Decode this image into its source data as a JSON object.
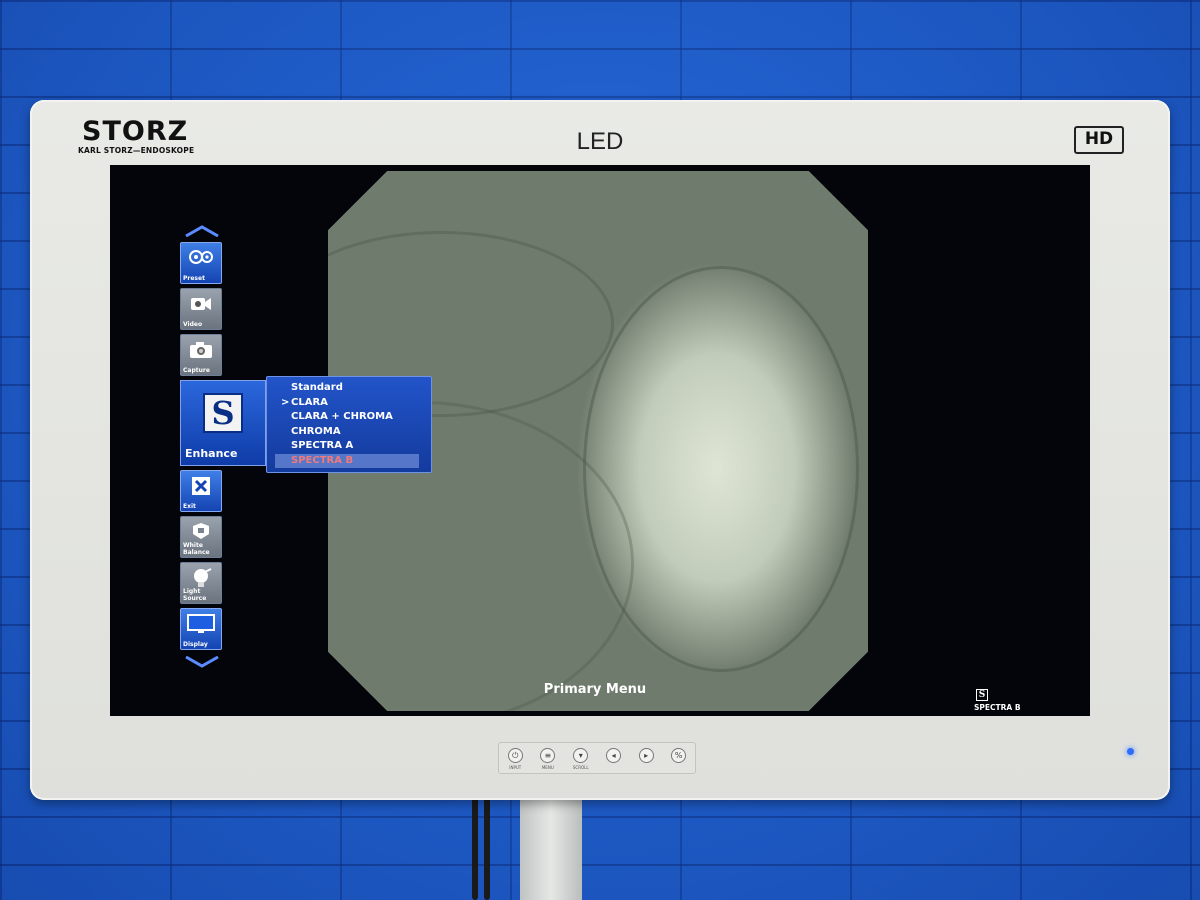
{
  "monitor": {
    "brand": "STORZ",
    "brand_sub": "KARL STORZ—ENDOSKOPE",
    "model_label": "LED",
    "badge": "HD"
  },
  "side_menu": {
    "items": [
      {
        "id": "preset",
        "label": "Preset",
        "icon": "gears-icon"
      },
      {
        "id": "video",
        "label": "Video",
        "icon": "video-camera-icon"
      },
      {
        "id": "capture",
        "label": "Capture",
        "icon": "camera-icon"
      },
      {
        "id": "enhance",
        "label": "Enhance",
        "icon": "s-enhance-icon"
      },
      {
        "id": "exit",
        "label": "Exit",
        "icon": "close-icon"
      },
      {
        "id": "white_balance",
        "label": "White Balance",
        "icon": "white-balance-icon"
      },
      {
        "id": "light_source",
        "label": "Light Source",
        "icon": "light-bulb-icon"
      },
      {
        "id": "display",
        "label": "Display",
        "icon": "monitor-icon"
      }
    ],
    "enhance_glyph": "S"
  },
  "enhance_submenu": {
    "options": [
      "Standard",
      "CLARA",
      "CLARA + CHROMA",
      "CHROMA",
      "SPECTRA A",
      "SPECTRA B"
    ],
    "current": "CLARA",
    "highlighted": "SPECTRA B"
  },
  "screen": {
    "menu_title": "Primary Menu",
    "status_icon_glyph": "S",
    "status_mode": "SPECTRA B"
  },
  "controls": {
    "buttons": [
      {
        "label": "INPUT",
        "icon": "input-icon"
      },
      {
        "label": "MENU",
        "icon": "menu-icon"
      },
      {
        "label": "SCROLL",
        "icon": "scroll-down-icon"
      },
      {
        "label": "",
        "icon": "left-arrow-icon"
      },
      {
        "label": "",
        "icon": "right-arrow-icon"
      },
      {
        "label": "",
        "icon": "percent-icon"
      }
    ],
    "power_led_color": "#2d6bff"
  }
}
